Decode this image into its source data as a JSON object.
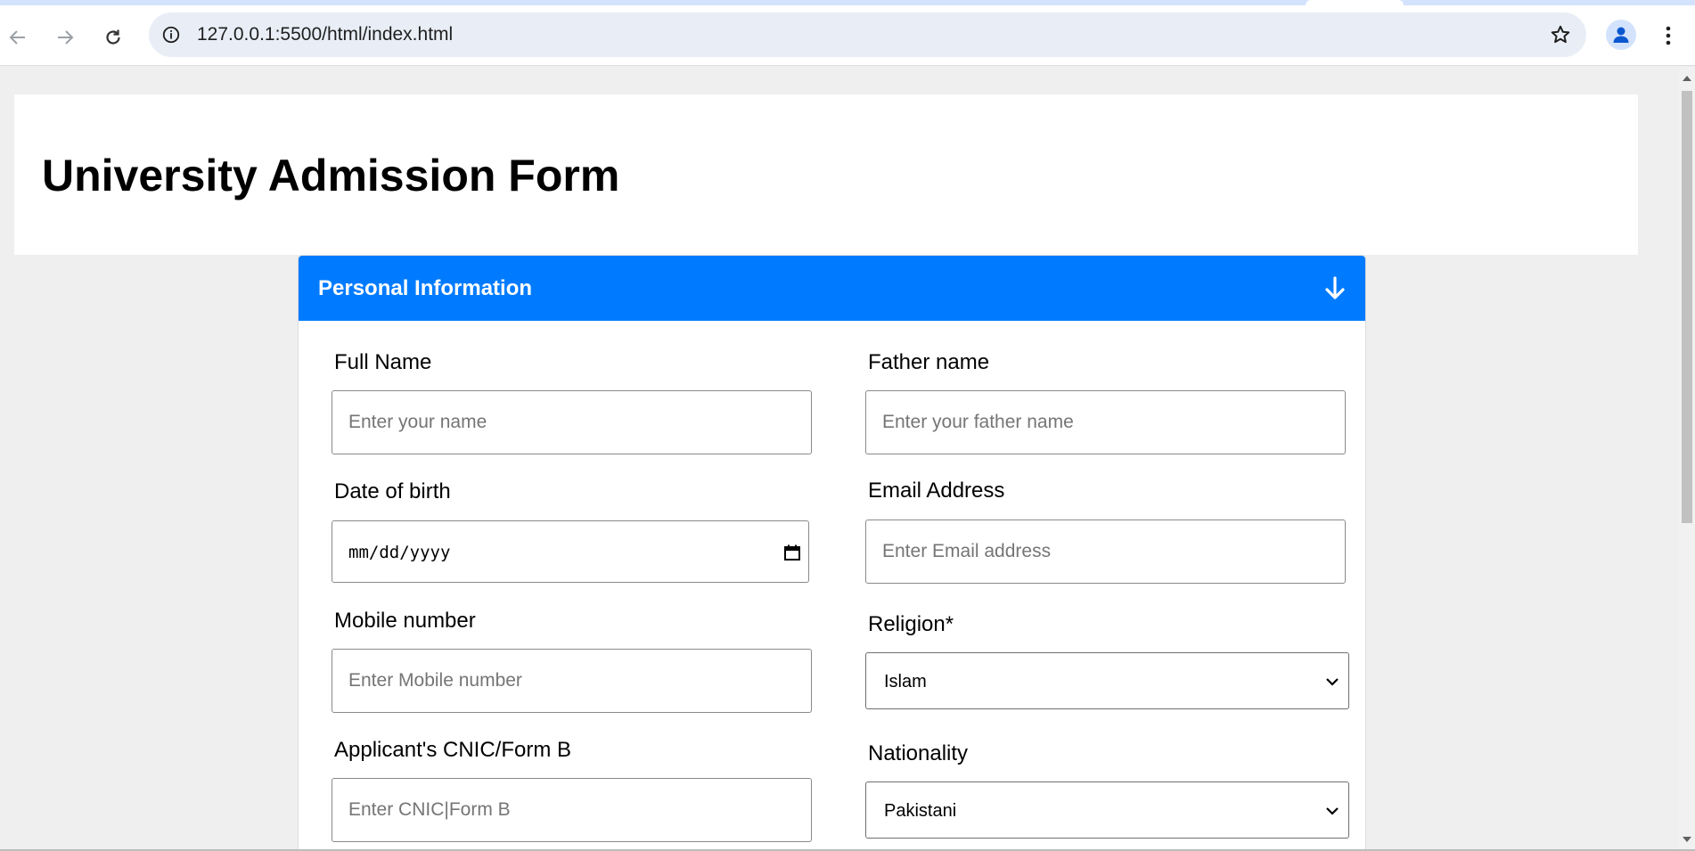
{
  "browser": {
    "url": "127.0.0.1:5500/html/index.html",
    "icons": {
      "back": "arrow-left-icon",
      "forward": "arrow-right-icon",
      "reload": "reload-icon",
      "site_info": "info-icon",
      "bookmark": "star-icon",
      "profile": "person-icon",
      "menu": "kebab-menu-icon"
    }
  },
  "page": {
    "title": "University Admission Form"
  },
  "section": {
    "title": "Personal Information",
    "toggle_icon": "arrow-down-icon",
    "accent_color": "#007bff"
  },
  "form": {
    "full_name": {
      "label": "Full Name",
      "placeholder": "Enter your name"
    },
    "father_name": {
      "label": "Father name",
      "placeholder": "Enter your father name"
    },
    "dob": {
      "label": "Date of birth",
      "value": "mm/dd/yyyy"
    },
    "email": {
      "label": "Email Address",
      "placeholder": "Enter Email address"
    },
    "mobile": {
      "label": "Mobile number",
      "placeholder": "Enter Mobile number"
    },
    "religion": {
      "label": "Religion*",
      "value": "Islam"
    },
    "cnic": {
      "label": "Applicant's CNIC/Form B",
      "placeholder": "Enter CNIC|Form B"
    },
    "nationality": {
      "label": "Nationality",
      "value": "Pakistani"
    }
  }
}
